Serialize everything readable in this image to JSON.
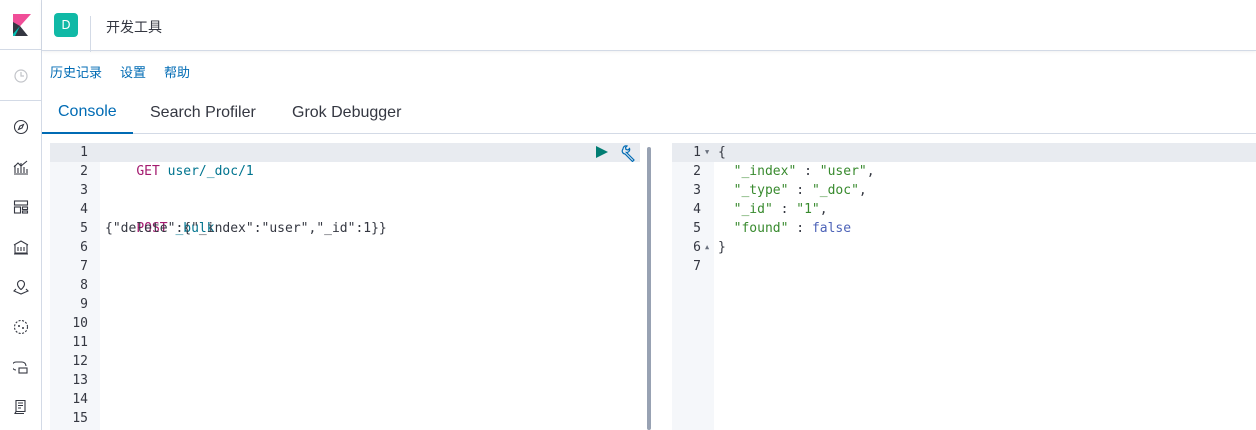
{
  "header": {
    "space_initial": "D",
    "title": "开发工具"
  },
  "menu": {
    "history": "历史记录",
    "settings": "设置",
    "help": "帮助"
  },
  "tabs": {
    "console": "Console",
    "search_profiler": "Search Profiler",
    "grok_debugger": "Grok Debugger"
  },
  "request_editor": {
    "line_numbers": [
      "1",
      "2",
      "3",
      "4",
      "5",
      "6",
      "7",
      "8",
      "9",
      "10",
      "11",
      "12",
      "13",
      "14",
      "15"
    ],
    "line1_method": "GET",
    "line1_path": " user/_doc/1",
    "line4_method": "POST",
    "line4_path": " _bulk",
    "line5": "{\"delete\":{\"_index\":\"user\",\"_id\":1}}"
  },
  "response_editor": {
    "line_numbers": [
      "1",
      "2",
      "3",
      "4",
      "5",
      "6",
      "7"
    ],
    "l1": "{",
    "l2_key": "  \"_index\"",
    "l2_sep": " : ",
    "l2_val": "\"user\"",
    "l2_end": ",",
    "l3_key": "  \"_type\"",
    "l3_sep": " : ",
    "l3_val": "\"_doc\"",
    "l3_end": ",",
    "l4_key": "  \"_id\"",
    "l4_sep": " : ",
    "l4_val": "\"1\"",
    "l4_end": ",",
    "l5_key": "  \"found\"",
    "l5_sep": " : ",
    "l5_val": "false",
    "l6": "}"
  },
  "colors": {
    "accent": "#006bb4",
    "space_avatar": "#10b9a6",
    "run_button": "#017d73"
  },
  "icons": {
    "logo": "kibana-logo-icon",
    "rail": [
      "clock-icon",
      "compass-icon",
      "visualize-icon",
      "dashboard-icon",
      "canvas-icon",
      "maps-icon",
      "ml-icon",
      "infra-icon",
      "logs-icon"
    ],
    "run": "play-icon",
    "settings": "wrench-icon"
  }
}
